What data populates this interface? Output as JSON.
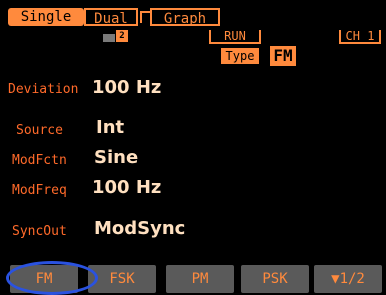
{
  "tabs": [
    {
      "label": "Single"
    },
    {
      "label": "Dual"
    },
    {
      "label": "Graph"
    }
  ],
  "indicators": {
    "memory_slot": "2",
    "run_label": "RUN",
    "channel_label": "CH 1",
    "type_label": "Type",
    "type_value": "FM"
  },
  "params": {
    "deviation": {
      "label": "Deviation",
      "value": "100 Hz"
    },
    "source": {
      "label": "Source",
      "value": "Int"
    },
    "modfctn": {
      "label": "ModFctn",
      "value": "Sine"
    },
    "modfreq": {
      "label": "ModFreq",
      "value": "100 Hz"
    },
    "syncout": {
      "label": "SyncOut",
      "value": "ModSync"
    }
  },
  "softkeys": [
    {
      "label": "FM"
    },
    {
      "label": "FSK"
    },
    {
      "label": "PM"
    },
    {
      "label": "PSK"
    },
    {
      "label": "▼1/2"
    }
  ],
  "colors": {
    "accent": "#ff8a3d",
    "value_text": "#ffe0c0",
    "softkey_bg": "#5a5a5a",
    "highlight": "#2a52e0"
  }
}
